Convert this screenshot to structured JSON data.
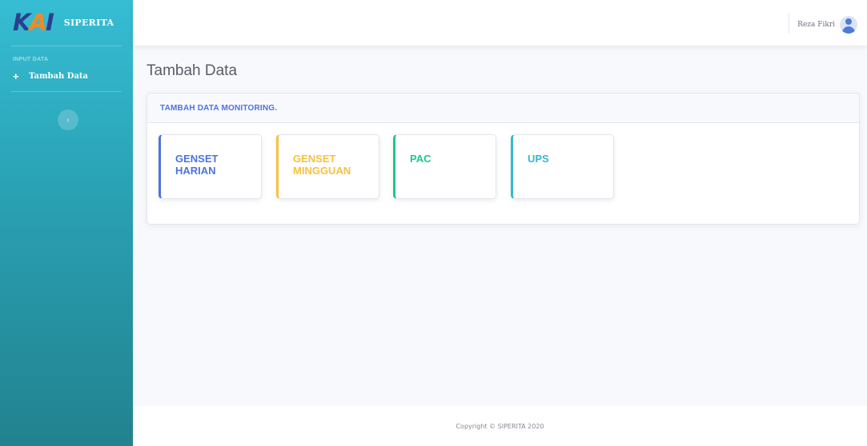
{
  "app": {
    "brand_name": "SIPERITA",
    "logo": {
      "k": "K",
      "a": "A",
      "i": "I"
    }
  },
  "sidebar": {
    "heading": "INPUT DATA",
    "items": [
      {
        "icon": "plus-icon",
        "label": "Tambah Data"
      }
    ],
    "toggle_icon": "chevron-left-icon",
    "toggle_glyph": "‹"
  },
  "topbar": {
    "user_name": "Reza Fikri",
    "avatar_icon": "user-avatar-icon"
  },
  "main": {
    "page_title": "Tambah Data",
    "card_title": "TAMBAH DATA MONITORING.",
    "tiles": [
      {
        "label": "GENSET HARIAN",
        "color": "#4e73df"
      },
      {
        "label": "GENSET MINGGUAN",
        "color": "#f6c23e"
      },
      {
        "label": "PAC",
        "color": "#1cc88a"
      },
      {
        "label": "UPS",
        "color": "#36b9cc"
      }
    ]
  },
  "footer": {
    "text": "Copyright © SIPERITA 2020"
  },
  "colors": {
    "primary": "#4e73df",
    "sidebar_top": "#36bdd4",
    "sidebar_bottom": "#22828f"
  }
}
